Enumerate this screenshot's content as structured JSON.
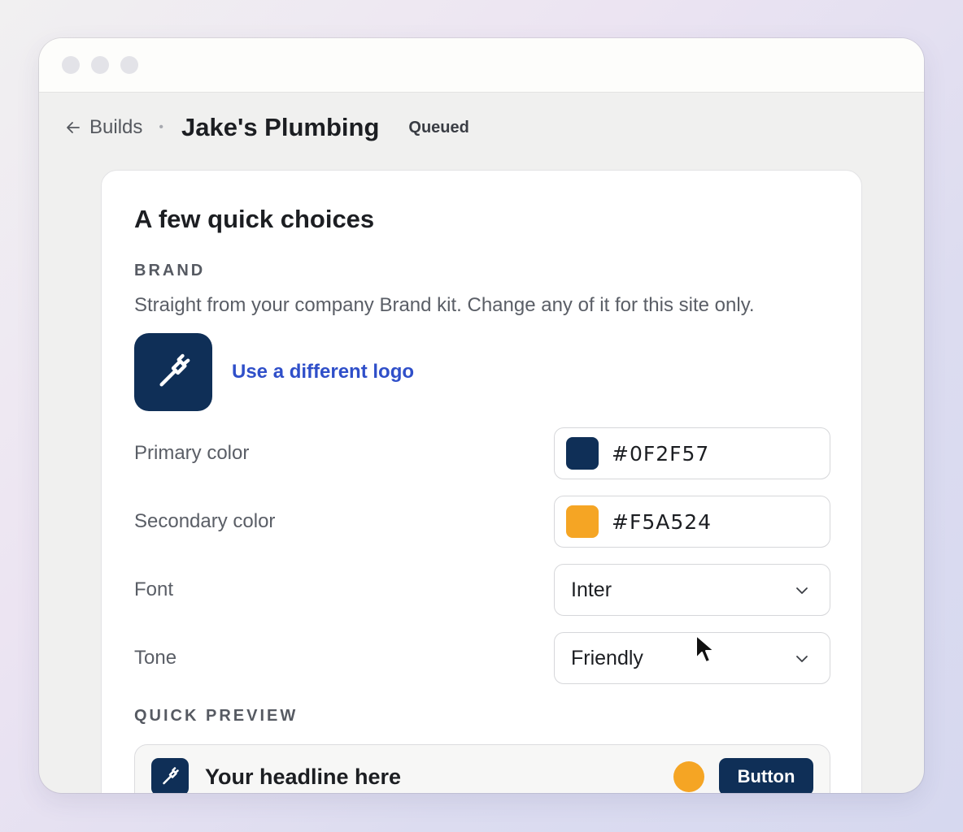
{
  "header": {
    "back_label": "Builds",
    "title": "Jake's Plumbing",
    "status": "Queued"
  },
  "card": {
    "title": "A few quick choices",
    "brand_label": "BRAND",
    "brand_desc": "Straight from your company Brand kit. Change any of it for this site only.",
    "logo_link": "Use a different logo",
    "primary": {
      "label": "Primary color",
      "value": "#0F2F57",
      "color": "#0F2F57"
    },
    "secondary": {
      "label": "Secondary color",
      "value": "#F5A524",
      "color": "#F5A524"
    },
    "font": {
      "label": "Font",
      "value": "Inter"
    },
    "tone": {
      "label": "Tone",
      "value": "Friendly"
    },
    "preview_label": "QUICK PREVIEW",
    "preview": {
      "headline": "Your headline here",
      "button": "Button"
    }
  },
  "icons": {
    "back": "arrow-left-icon",
    "logo": "wrench-icon",
    "chevron": "chevron-down-icon",
    "cursor": "mouse-pointer-icon"
  }
}
